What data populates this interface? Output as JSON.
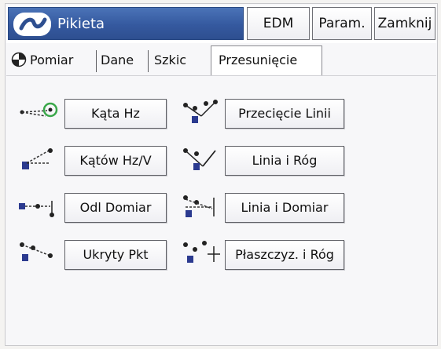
{
  "window": {
    "title": "Pikieta",
    "buttons": {
      "edm": "EDM",
      "param": "Param.",
      "close": "Zamknij"
    }
  },
  "tabs": [
    "Pomiar",
    "Dane",
    "Szkic",
    "Przesunięcie"
  ],
  "active_tab": "Przesunięcie",
  "functions": {
    "left": [
      {
        "label": "Kąta Hz",
        "icon": "angle-hz-offset-icon"
      },
      {
        "label": "Kątów Hz/V",
        "icon": "angle-hz-v-offset-icon"
      },
      {
        "label": "Odl Domiar",
        "icon": "distance-offset-icon"
      },
      {
        "label": "Ukryty Pkt",
        "icon": "hidden-point-icon"
      }
    ],
    "right": [
      {
        "label": "Przecięcie Linii",
        "icon": "line-intersection-icon"
      },
      {
        "label": "Linia i Róg",
        "icon": "line-and-corner-icon"
      },
      {
        "label": "Linia i Domiar",
        "icon": "line-and-offset-icon"
      },
      {
        "label": "Płaszczyz. i Róg",
        "icon": "plane-and-corner-icon"
      }
    ]
  },
  "colors": {
    "title_bar": "#35599f",
    "instrument": "#2b3a8f",
    "target_green": "#3aa84a"
  }
}
